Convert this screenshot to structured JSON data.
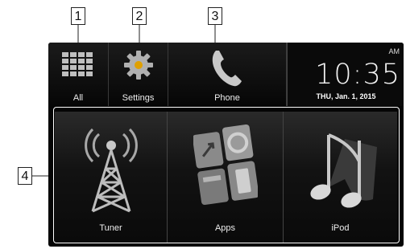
{
  "callouts": {
    "c1": "1",
    "c2": "2",
    "c3": "3",
    "c4": "4"
  },
  "top_buttons": {
    "all": {
      "label": "All",
      "icon": "grid-icon"
    },
    "settings": {
      "label": "Settings",
      "icon": "gear-icon"
    },
    "phone": {
      "label": "Phone",
      "icon": "phone-icon"
    }
  },
  "clock": {
    "time": "10:35",
    "ampm": "AM",
    "date": "THU, Jan. 1, 2015"
  },
  "app_buttons": {
    "tuner": {
      "label": "Tuner",
      "icon": "antenna-tower-icon"
    },
    "apps": {
      "label": "Apps",
      "icon": "apps-icon"
    },
    "ipod": {
      "label": "iPod",
      "icon": "music-note-icon"
    }
  },
  "colors": {
    "screen_bg": "#050505",
    "accent_blue": "#3a7bd5",
    "icon_gray": "#9a9a9a"
  }
}
